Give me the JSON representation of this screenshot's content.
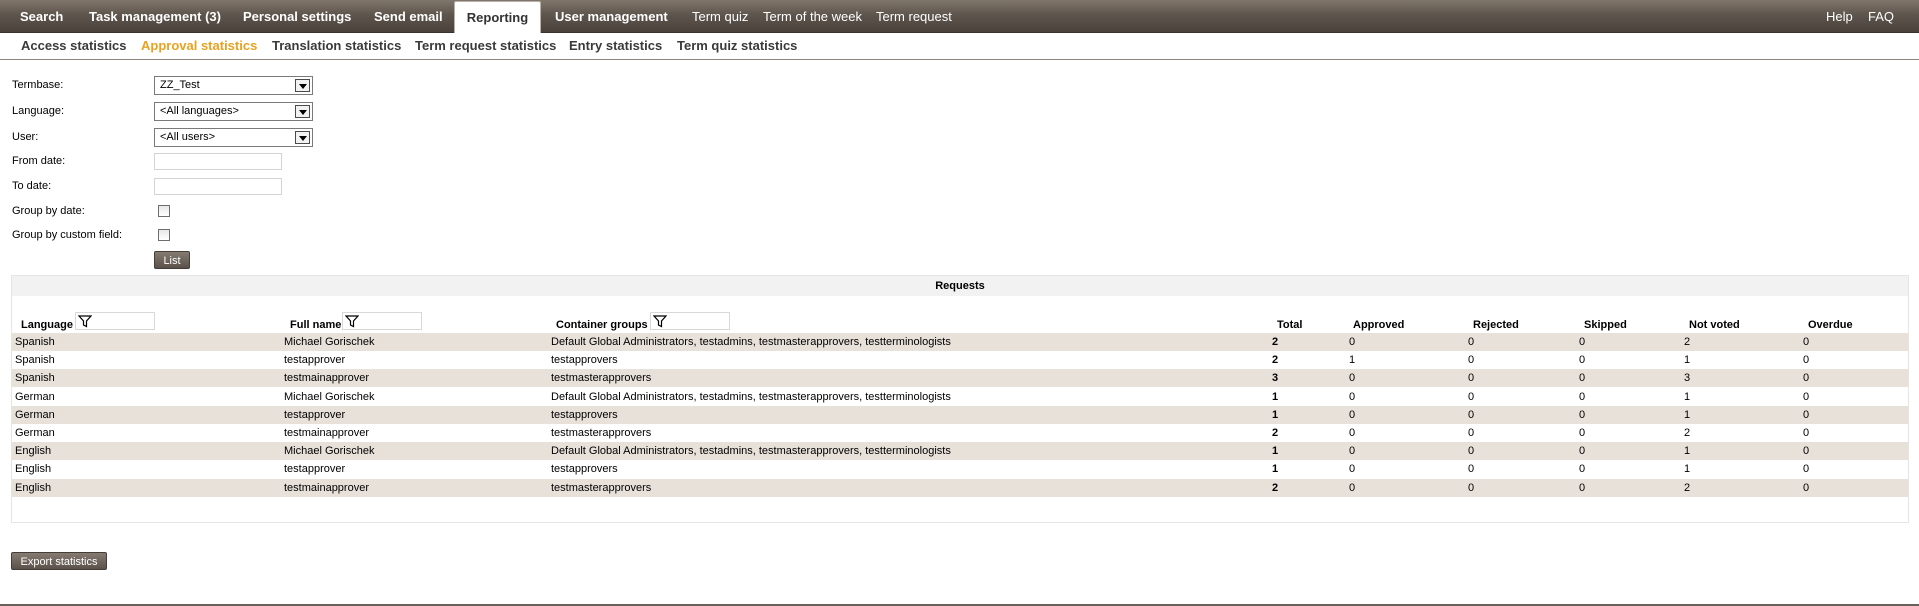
{
  "topnav": {
    "items": [
      "Search",
      "Task management (3)",
      "Personal settings",
      "Send email",
      "Reporting",
      "User management",
      "Term quiz",
      "Term of the week",
      "Term request"
    ],
    "right": [
      "Help",
      "FAQ"
    ]
  },
  "subnav": {
    "items": [
      "Access statistics",
      "Approval statistics",
      "Translation statistics",
      "Term request statistics",
      "Entry statistics",
      "Term quiz statistics"
    ]
  },
  "form": {
    "termbase_label": "Termbase:",
    "termbase_value": "ZZ_Test",
    "language_label": "Language:",
    "language_value": "<All languages>",
    "user_label": "User:",
    "user_value": "<All users>",
    "from_label": "From date:",
    "from_value": "",
    "to_label": "To date:",
    "to_value": "",
    "group_date_label": "Group by date:",
    "group_custom_label": "Group by custom field:",
    "list_button": "List"
  },
  "requests": {
    "title": "Requests",
    "headers": [
      "Language",
      "Full name",
      "Container groups",
      "Total",
      "Approved",
      "Rejected",
      "Skipped",
      "Not voted",
      "Overdue"
    ],
    "rows": [
      [
        "Spanish",
        "Michael Gorischek",
        "Default Global Administrators, testadmins, testmasterapprovers, testterminologists",
        "2",
        "0",
        "0",
        "0",
        "2",
        "0"
      ],
      [
        "Spanish",
        "testapprover",
        "testapprovers",
        "2",
        "1",
        "0",
        "0",
        "1",
        "0"
      ],
      [
        "Spanish",
        "testmainapprover",
        "testmasterapprovers",
        "3",
        "0",
        "0",
        "0",
        "3",
        "0"
      ],
      [
        "German",
        "Michael Gorischek",
        "Default Global Administrators, testadmins, testmasterapprovers, testterminologists",
        "1",
        "0",
        "0",
        "0",
        "1",
        "0"
      ],
      [
        "German",
        "testapprover",
        "testapprovers",
        "1",
        "0",
        "0",
        "0",
        "1",
        "0"
      ],
      [
        "German",
        "testmainapprover",
        "testmasterapprovers",
        "2",
        "0",
        "0",
        "0",
        "2",
        "0"
      ],
      [
        "English",
        "Michael Gorischek",
        "Default Global Administrators, testadmins, testmasterapprovers, testterminologists",
        "1",
        "0",
        "0",
        "0",
        "1",
        "0"
      ],
      [
        "English",
        "testapprover",
        "testapprovers",
        "1",
        "0",
        "0",
        "0",
        "1",
        "0"
      ],
      [
        "English",
        "testmainapprover",
        "testmasterapprovers",
        "2",
        "0",
        "0",
        "0",
        "2",
        "0"
      ]
    ]
  },
  "export_button": "Export statistics",
  "icons": {
    "filter": "filter-icon",
    "dropdown": "dropdown-arrow-icon"
  },
  "colors": {
    "active_subnav": "#e9a21f",
    "nav_bg": "#5e554d",
    "row_shade": "#e8e1da"
  }
}
